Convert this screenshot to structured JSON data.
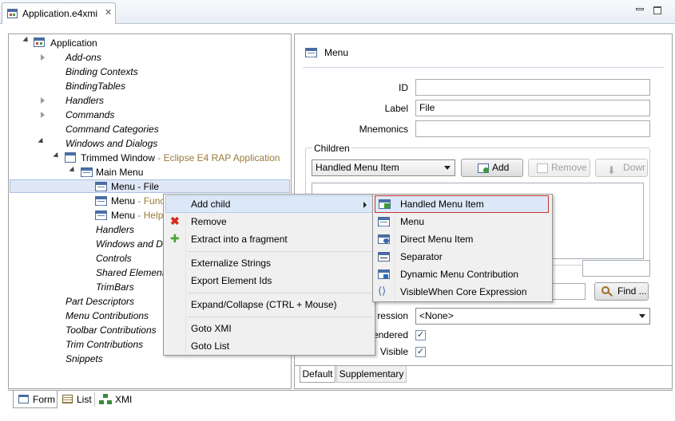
{
  "editor": {
    "tab_title": "Application.e4xmi",
    "tab_close_icon": "close-icon",
    "minimize_icon": "minimize-icon",
    "maximize_icon": "maximize-icon"
  },
  "tree": {
    "root": "Application",
    "items": [
      {
        "label": "Add-ons"
      },
      {
        "label": "Binding Contexts"
      },
      {
        "label": "BindingTables"
      },
      {
        "label": "Handlers"
      },
      {
        "label": "Commands"
      },
      {
        "label": "Command Categories"
      },
      {
        "label": "Windows and Dialogs"
      },
      {
        "label": "Trimmed Window",
        "suffix": " - Eclipse E4 RAP Application"
      },
      {
        "label": "Main Menu"
      },
      {
        "label": "Menu - File"
      },
      {
        "label": "Menu",
        "suffix": " - Func"
      },
      {
        "label": "Menu",
        "suffix": " - Help"
      },
      {
        "label": "Handlers"
      },
      {
        "label": "Windows and D"
      },
      {
        "label": "Controls"
      },
      {
        "label": "Shared Elements"
      },
      {
        "label": "TrimBars"
      },
      {
        "label": "Part Descriptors"
      },
      {
        "label": "Menu Contributions"
      },
      {
        "label": "Toolbar Contributions"
      },
      {
        "label": "Trim Contributions"
      },
      {
        "label": "Snippets"
      }
    ]
  },
  "detail": {
    "title": "Menu",
    "id_label": "ID",
    "id_value": "",
    "label_label": "Label",
    "label_value": "File",
    "mnemonics_label": "Mnemonics",
    "mnemonics_value": "",
    "children_group": "Children",
    "children_type": "Handled Menu Item",
    "add_button": "Add",
    "remove_button": "Remove",
    "down_button": "Dowr",
    "find_button": "Find ...",
    "expression_label": "ression",
    "expression_value": "<None>",
    "rendered_label": "endered",
    "visible_label": "Visible",
    "rendered_checked": "✓",
    "visible_checked": "✓",
    "tab_default": "Default",
    "tab_supplementary": "Supplementary"
  },
  "context_menu": {
    "items": [
      {
        "label": "Add child",
        "has_submenu": true
      },
      {
        "label": "Remove"
      },
      {
        "label": "Extract into a fragment"
      },
      {
        "label": "Externalize Strings"
      },
      {
        "label": "Export Element Ids"
      },
      {
        "label": "Expand/Collapse (CTRL + Mouse)"
      },
      {
        "label": "Goto XMI"
      },
      {
        "label": "Goto List"
      }
    ]
  },
  "submenu": {
    "items": [
      {
        "label": "Handled Menu Item"
      },
      {
        "label": "Menu"
      },
      {
        "label": "Direct Menu Item"
      },
      {
        "label": "Separator"
      },
      {
        "label": "Dynamic Menu Contribution"
      },
      {
        "label": "VisibleWhen Core Expression"
      }
    ]
  },
  "bottom_tabs": {
    "form": "Form",
    "list": "List",
    "xmi": "XMI"
  },
  "colors": {
    "selection": "#dfe8f6",
    "accent": "#4a6ea6",
    "highlight_border": "#cc3333",
    "window_suffix": "#9c7a3a"
  }
}
